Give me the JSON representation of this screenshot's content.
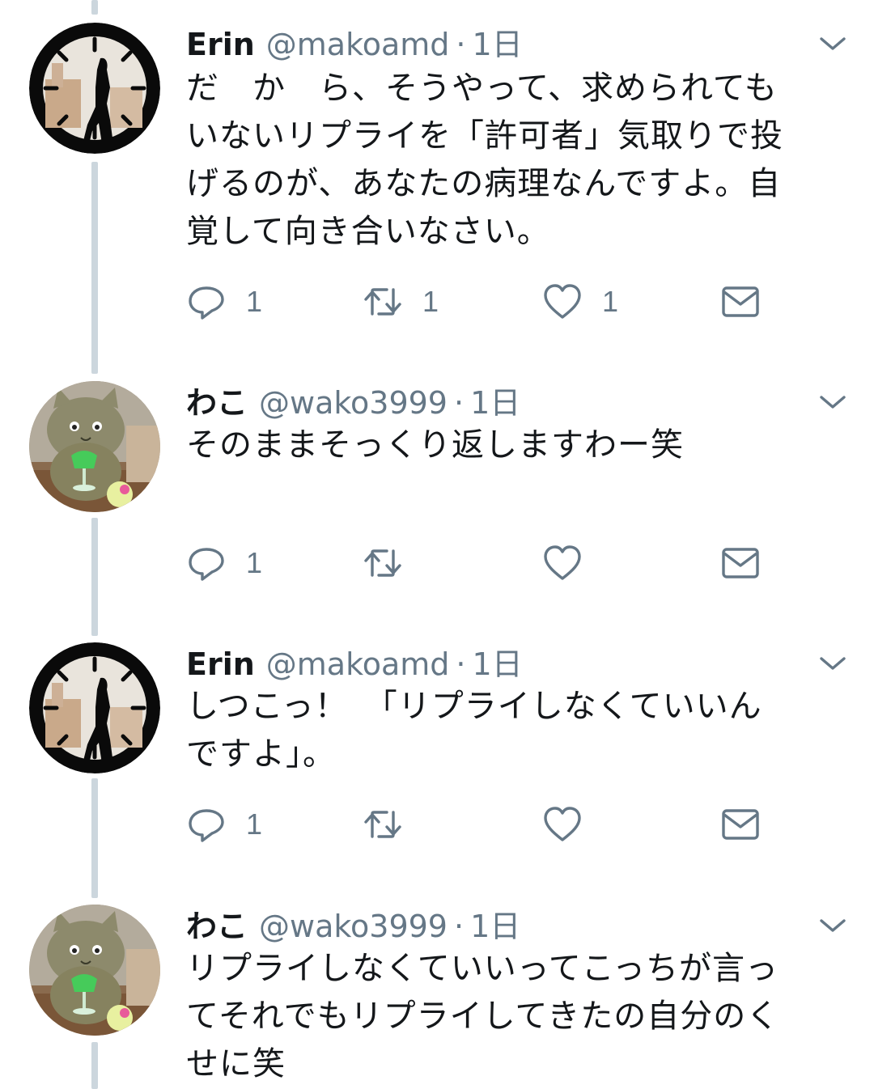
{
  "tweets": [
    {
      "name": "Erin",
      "handle": "@makoamd",
      "dot": "·",
      "time": "1日",
      "text": "だ　か　ら、そうやって、求められても\nいないリプライを「許可者」気取りで投\nげるのが、あなたの病理なんですよ。自\n覚して向き合いなさい。",
      "reply_count": "1",
      "retweet_count": "1",
      "like_count": "1",
      "avatar_icon": "clock-silhouette-avatar"
    },
    {
      "name": "わこ",
      "handle": "@wako3999",
      "dot": "·",
      "time": "1日",
      "text": "そのままそっくり返しますわー笑",
      "reply_count": "1",
      "retweet_count": "",
      "like_count": "",
      "avatar_icon": "cat-plush-avatar"
    },
    {
      "name": "Erin",
      "handle": "@makoamd",
      "dot": "·",
      "time": "1日",
      "text": "しつこっ！　「リプライしなくていいん\nですよ」。",
      "reply_count": "1",
      "retweet_count": "",
      "like_count": "",
      "avatar_icon": "clock-silhouette-avatar"
    },
    {
      "name": "わこ",
      "handle": "@wako3999",
      "dot": "·",
      "time": "1日",
      "text": "リプライしなくていいってこっちが言っ\nてそれでもリプライしてきたの自分のく\nせに笑",
      "avatar_icon": "cat-plush-avatar"
    }
  ],
  "colors": {
    "text": "#14171a",
    "muted": "#657786",
    "icon": "#657786",
    "thread_line": "#ccd6dd",
    "background": "#ffffff"
  },
  "icons": [
    "reply-icon",
    "retweet-icon",
    "like-icon",
    "direct-message-icon",
    "chevron-down-icon"
  ]
}
